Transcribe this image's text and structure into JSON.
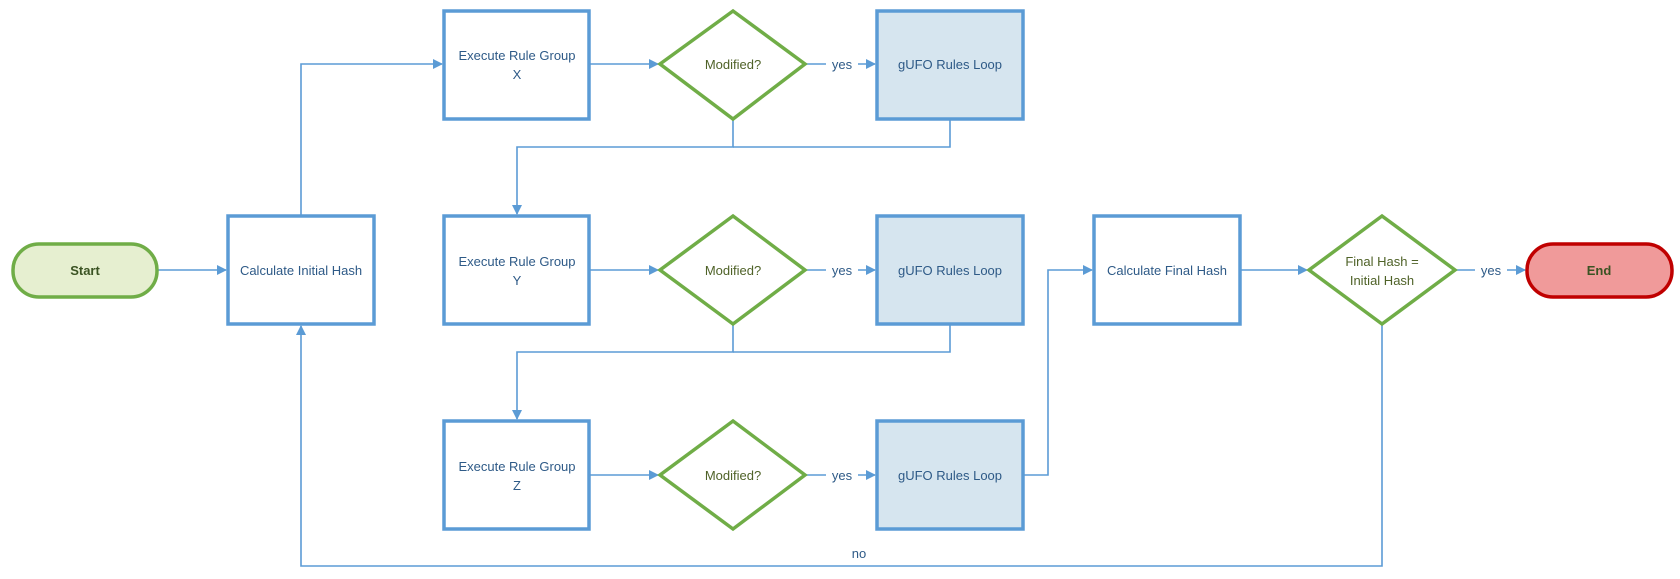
{
  "colors": {
    "process_border": "#5B9BD5",
    "decision_border": "#70AD47",
    "loop_fill": "#D6E5EF",
    "start_fill": "#E6EFD0",
    "start_border": "#70AD47",
    "end_fill": "#F09A9A",
    "end_border": "#C00000"
  },
  "nodes": {
    "start": "Start",
    "calc_initial": "Calculate Initial Hash",
    "exec_x": [
      "Execute Rule Group",
      "X"
    ],
    "exec_y": [
      "Execute Rule Group",
      "Y"
    ],
    "exec_z": [
      "Execute Rule Group",
      "Z"
    ],
    "modified_x": "Modified?",
    "modified_y": "Modified?",
    "modified_z": "Modified?",
    "loop_x": "gUFO Rules Loop",
    "loop_y": "gUFO Rules Loop",
    "loop_z": "gUFO Rules Loop",
    "calc_final": "Calculate Final Hash",
    "compare": [
      "Final Hash =",
      "Initial Hash"
    ],
    "end": "End"
  },
  "edges": {
    "yes_x": "yes",
    "yes_y": "yes",
    "yes_z": "yes",
    "yes_end": "yes",
    "no": "no"
  }
}
